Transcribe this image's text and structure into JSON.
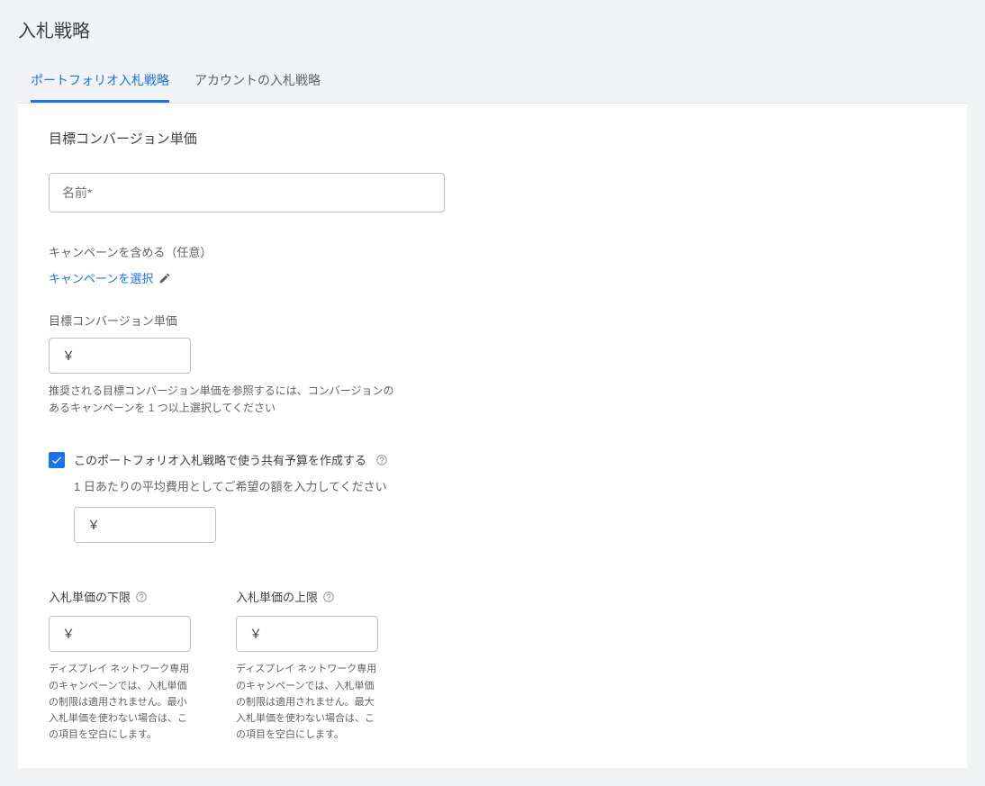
{
  "page_title": "入札戦略",
  "tabs": [
    {
      "label": "ポートフォリオ入札戦略",
      "active": true
    },
    {
      "label": "アカウントの入札戦略",
      "active": false
    }
  ],
  "form": {
    "section_title": "目標コンバージョン単価",
    "name_placeholder": "名前*",
    "campaign_include_label": "キャンペーンを含める（任意）",
    "campaign_select_link": "キャンペーンを選択",
    "target_cpa_label": "目標コンバージョン単価",
    "currency_symbol": "￥",
    "target_cpa_help": "推奨される目標コンバージョン単価を参照するには、コンバージョンのあるキャンペーンを 1 つ以上選択してください",
    "shared_budget_checkbox_label": "このポートフォリオ入札戦略で使う共有予算を作成する",
    "daily_avg_label": "1 日あたりの平均費用としてご希望の額を入力してください",
    "min_bid_label": "入札単価の下限",
    "max_bid_label": "入札単価の上限",
    "min_bid_help": "ディスプレイ ネットワーク専用のキャンペーンでは、入札単価の制限は適用されません。最小入札単価を使わない場合は、この項目を空白にします。",
    "max_bid_help": "ディスプレイ ネットワーク専用のキャンペーンでは、入札単価の制限は適用されません。最大入札単価を使わない場合は、この項目を空白にします。"
  }
}
